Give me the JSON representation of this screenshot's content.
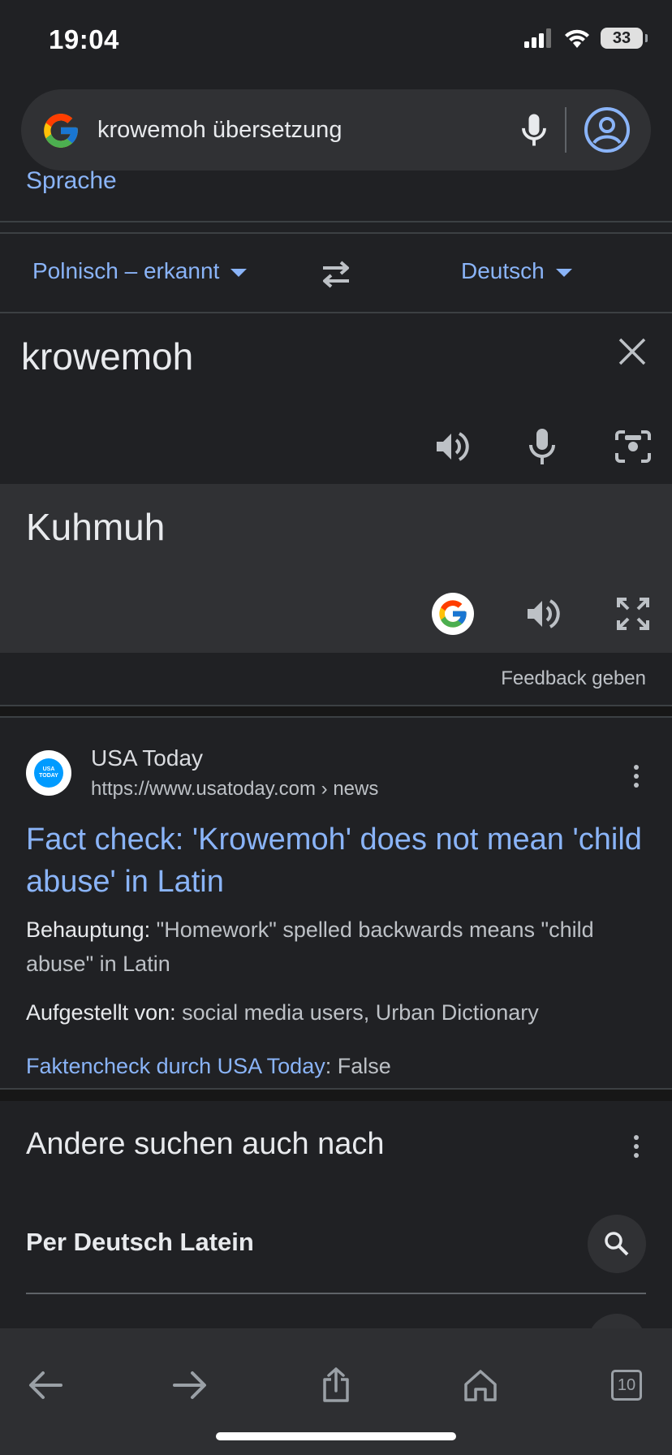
{
  "status_bar": {
    "time": "19:04",
    "battery": "33",
    "icons": [
      "cellular-signal-icon",
      "wifi-icon",
      "battery-icon"
    ]
  },
  "search": {
    "query": "krowemoh übersetzung",
    "icons": [
      "google-logo-icon",
      "microphone-icon",
      "account-icon"
    ]
  },
  "partial_link": "Sprache",
  "translator": {
    "source_language": "Polnisch – erkannt",
    "target_language": "Deutsch",
    "source_text": "krowemoh",
    "translated_text": "Kuhmuh",
    "icons": [
      "swap-languages-icon",
      "clear-icon",
      "speaker-icon",
      "microphone-icon",
      "camera-icon",
      "google-icon",
      "fullscreen-icon"
    ],
    "feedback": "Feedback geben"
  },
  "result": {
    "site_name": "USA Today",
    "favicon_text": "USA TODAY",
    "url": "https://www.usatoday.com › news",
    "title": "Fact check: 'Krowemoh' does not mean 'child abuse' in Latin",
    "claim_label": "Behauptung:",
    "claim_text": " \"Homework\" spelled backwards means \"child abuse\" in Latin",
    "claimed_by_label": "Aufgestellt von:",
    "claimed_by_text": " social media users, Urban Dictionary",
    "factcheck_link": "Faktencheck durch USA Today",
    "factcheck_sep": ":",
    "factcheck_value": " False"
  },
  "people_also_search": {
    "title": "Andere suchen auch nach",
    "items": [
      {
        "label": "Per Deutsch Latein"
      }
    ]
  },
  "toolbar": {
    "tabs_count": "10",
    "icons": [
      "back-icon",
      "forward-icon",
      "share-icon",
      "home-icon",
      "tabs-icon"
    ]
  },
  "colors": {
    "background": "#202124",
    "panel": "#303134",
    "link": "#8ab4f8",
    "text": "#e8eaed",
    "muted": "#bdc1c6"
  }
}
